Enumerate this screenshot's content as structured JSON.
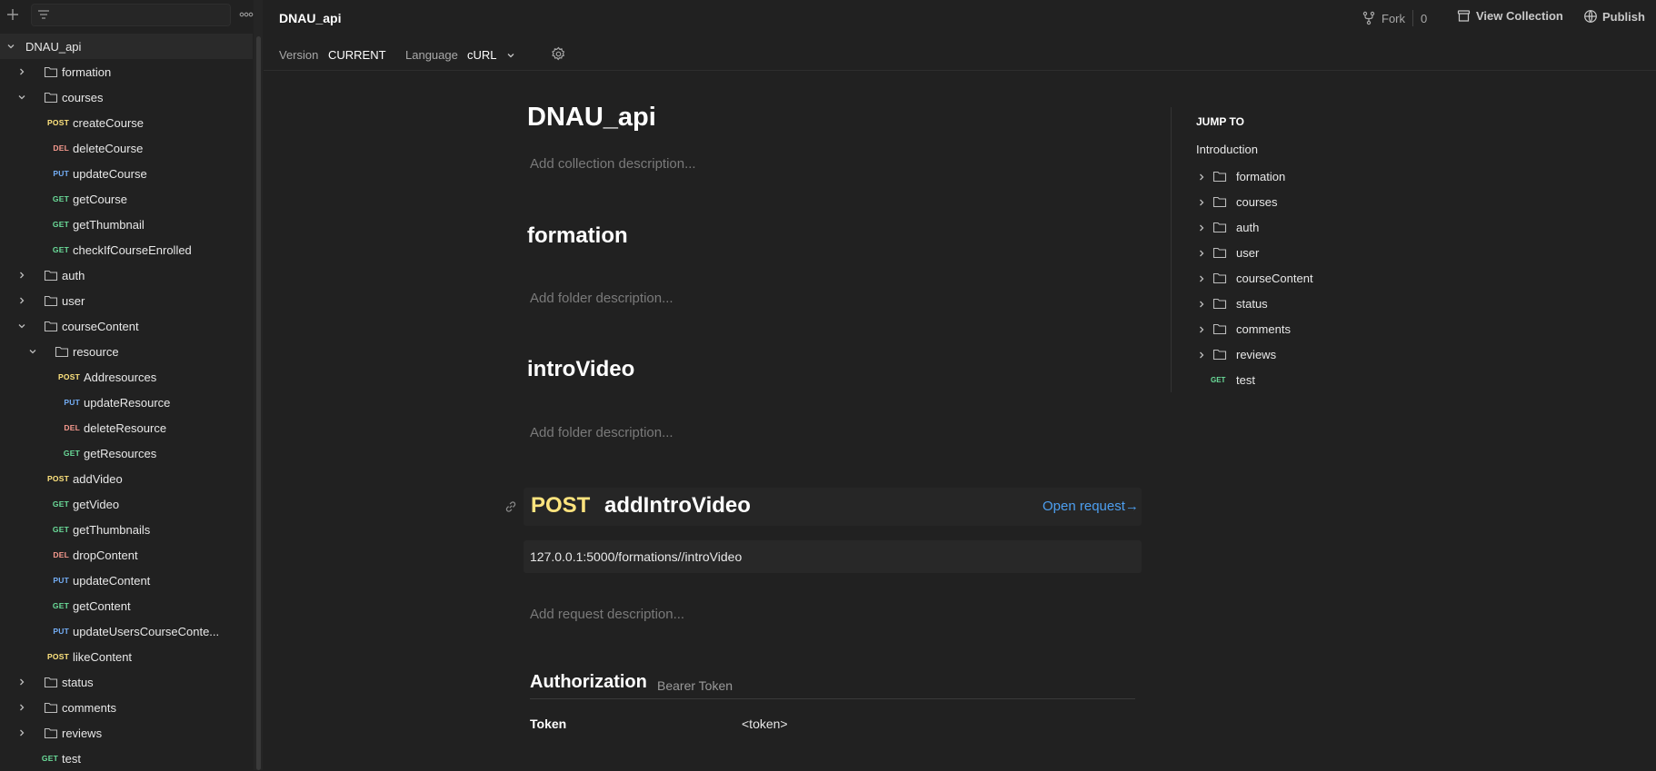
{
  "sidebar": {
    "tree": [
      {
        "kind": "collection",
        "label": "DNAU_api",
        "expanded": true
      },
      {
        "kind": "folder",
        "label": "formation",
        "expanded": false
      },
      {
        "kind": "folder",
        "label": "courses",
        "expanded": true
      },
      {
        "kind": "request",
        "method": "POST",
        "label": "createCourse"
      },
      {
        "kind": "request",
        "method": "DEL",
        "label": "deleteCourse"
      },
      {
        "kind": "request",
        "method": "PUT",
        "label": "updateCourse"
      },
      {
        "kind": "request",
        "method": "GET",
        "label": "getCourse"
      },
      {
        "kind": "request",
        "method": "GET",
        "label": "getThumbnail"
      },
      {
        "kind": "request",
        "method": "GET",
        "label": "checkIfCourseEnrolled"
      },
      {
        "kind": "folder",
        "label": "auth",
        "expanded": false
      },
      {
        "kind": "folder",
        "label": "user",
        "expanded": false
      },
      {
        "kind": "folder",
        "label": "courseContent",
        "expanded": true
      },
      {
        "kind": "folder",
        "label": "resource",
        "expanded": true
      },
      {
        "kind": "request",
        "method": "POST",
        "label": "Addresources"
      },
      {
        "kind": "request",
        "method": "PUT",
        "label": "updateResource"
      },
      {
        "kind": "request",
        "method": "DEL",
        "label": "deleteResource"
      },
      {
        "kind": "request",
        "method": "GET",
        "label": "getResources"
      },
      {
        "kind": "request",
        "method": "POST",
        "label": "addVideo"
      },
      {
        "kind": "request",
        "method": "GET",
        "label": "getVideo"
      },
      {
        "kind": "request",
        "method": "GET",
        "label": "getThumbnails"
      },
      {
        "kind": "request",
        "method": "DEL",
        "label": "dropContent"
      },
      {
        "kind": "request",
        "method": "PUT",
        "label": "updateContent"
      },
      {
        "kind": "request",
        "method": "GET",
        "label": "getContent"
      },
      {
        "kind": "request",
        "method": "PUT",
        "label": "updateUsersCourseConte..."
      },
      {
        "kind": "request",
        "method": "POST",
        "label": "likeContent"
      },
      {
        "kind": "folder",
        "label": "status",
        "expanded": false
      },
      {
        "kind": "folder",
        "label": "comments",
        "expanded": false
      },
      {
        "kind": "folder",
        "label": "reviews",
        "expanded": false
      },
      {
        "kind": "request",
        "method": "GET",
        "label": "test"
      }
    ]
  },
  "header": {
    "title": "DNAU_api",
    "fork_label": "Fork",
    "fork_count": "0",
    "view_collection": "View Collection",
    "publish": "Publish",
    "version_label": "Version",
    "version_value": "CURRENT",
    "language_label": "Language",
    "language_value": "cURL"
  },
  "doc": {
    "collection_title": "DNAU_api",
    "collection_desc_placeholder": "Add collection description...",
    "folder1_title": "formation",
    "folder1_desc_placeholder": "Add folder description...",
    "folder2_title": "introVideo",
    "folder2_desc_placeholder": "Add folder description...",
    "request": {
      "method": "POST",
      "name": "addIntroVideo",
      "open_label": "Open request→",
      "url": "127.0.0.1:5000/formations//introVideo",
      "desc_placeholder": "Add request description...",
      "auth_title": "Authorization",
      "auth_type": "Bearer Token",
      "token_label": "Token",
      "token_value": "<token>"
    }
  },
  "jump_to": {
    "title": "JUMP TO",
    "intro": "Introduction",
    "items": [
      {
        "kind": "folder",
        "label": "formation"
      },
      {
        "kind": "folder",
        "label": "courses"
      },
      {
        "kind": "folder",
        "label": "auth"
      },
      {
        "kind": "folder",
        "label": "user"
      },
      {
        "kind": "folder",
        "label": "courseContent"
      },
      {
        "kind": "folder",
        "label": "status"
      },
      {
        "kind": "folder",
        "label": "comments"
      },
      {
        "kind": "folder",
        "label": "reviews"
      },
      {
        "kind": "request",
        "method": "GET",
        "label": "test"
      }
    ]
  },
  "colors": {
    "post": "#ffe47e",
    "get": "#6bdd9a",
    "put": "#74aef6",
    "del": "#f79a8e",
    "link": "#4d9ff0"
  }
}
